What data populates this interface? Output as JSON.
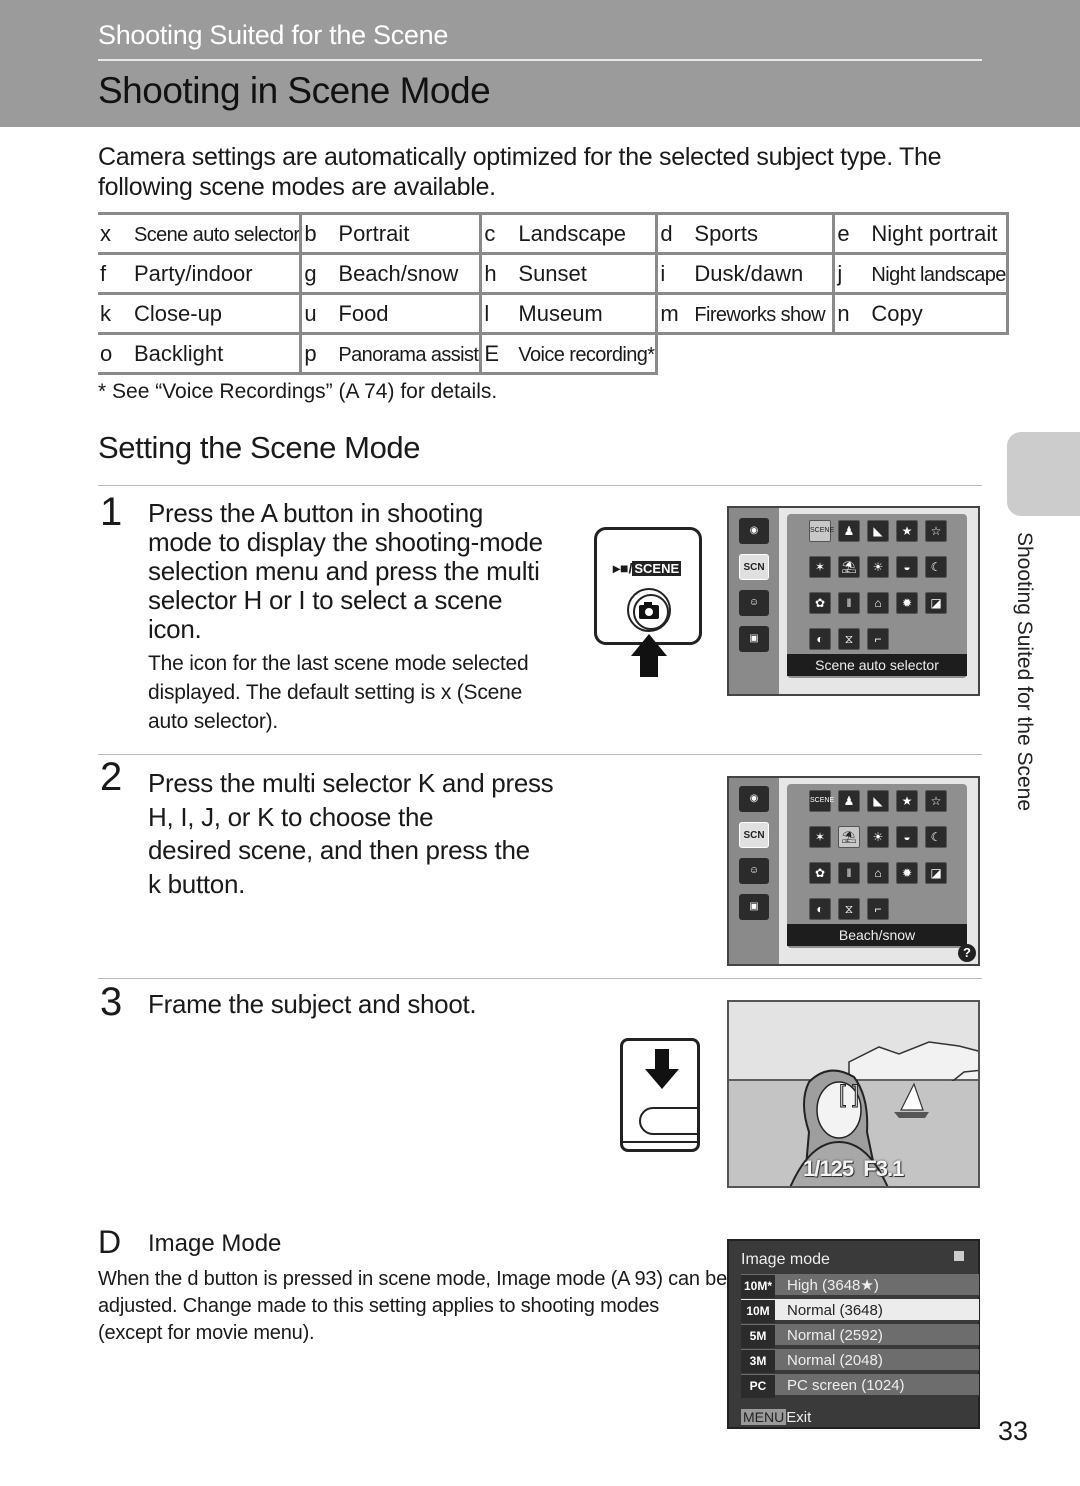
{
  "header": {
    "section": "Shooting Suited for the Scene",
    "title": "Shooting in Scene Mode"
  },
  "intro": "Camera settings are automatically optimized for the selected subject type. The following scene modes are available.",
  "scene_table": {
    "rows": [
      [
        {
          "key": "x",
          "label": "Scene auto selector"
        },
        {
          "key": "b",
          "label": "Portrait"
        },
        {
          "key": "c",
          "label": "Landscape"
        },
        {
          "key": "d",
          "label": "Sports"
        },
        {
          "key": "e",
          "label": "Night portrait"
        }
      ],
      [
        {
          "key": "f",
          "label": "Party/indoor"
        },
        {
          "key": "g",
          "label": "Beach/snow"
        },
        {
          "key": "h",
          "label": "Sunset"
        },
        {
          "key": "i",
          "label": "Dusk/dawn"
        },
        {
          "key": "j",
          "label": "Night landscape"
        }
      ],
      [
        {
          "key": "k",
          "label": "Close-up"
        },
        {
          "key": "u",
          "label": "Food"
        },
        {
          "key": "l",
          "label": "Museum"
        },
        {
          "key": "m",
          "label": "Fireworks show"
        },
        {
          "key": "n",
          "label": "Copy"
        }
      ],
      [
        {
          "key": "o",
          "label": "Backlight"
        },
        {
          "key": "p",
          "label": "Panorama assist"
        },
        {
          "key": "E",
          "label": "Voice recording*"
        }
      ]
    ],
    "footnote": "*  See “Voice Recordings” (A 74) for details."
  },
  "setting_section": {
    "title": "Setting the Scene Mode"
  },
  "steps": [
    {
      "number": "1",
      "text": [
        "Press the A button in shooting",
        "mode to display the shooting-mode",
        "selection menu and press the multi",
        "selector H or I to select a scene",
        "icon."
      ],
      "sub": [
        "The icon for the last scene mode selected",
        "displayed. The default setting is x (Scene",
        "auto selector)."
      ]
    },
    {
      "number": "2",
      "text": [
        "Press the multi selector K and press",
        "H, I, J, or K to choose the",
        "desired scene, and then press the",
        "k button."
      ]
    },
    {
      "number": "3",
      "text": [
        "Frame the subject and shoot."
      ]
    }
  ],
  "button_illustration": {
    "label_movie": "▸■/",
    "label_scene": "SCENE"
  },
  "screen1": {
    "side_icons": [
      "camera",
      "scene",
      "smile",
      "movie"
    ],
    "grid": [
      "SCENE",
      "♟",
      "◣",
      "★",
      "☆",
      "✶",
      "⛱",
      "☀",
      "◒",
      "☾",
      "✿",
      "‖",
      "⌂",
      "✹",
      "◪",
      "◐",
      "⧖",
      "⌐"
    ],
    "caption": "Scene auto selector",
    "selected_index": 0
  },
  "screen2": {
    "caption": "Beach/snow",
    "selected_index": 6,
    "help_icon": "?"
  },
  "photo": {
    "shutter": "1/125",
    "aperture": "F3.1"
  },
  "note": {
    "letter": "D",
    "title": "Image Mode",
    "body": "When the d button is pressed in scene mode, Image mode (A 93) can be adjusted. Change made to this setting applies to shooting modes (except for movie menu)."
  },
  "image_mode_menu": {
    "title": "Image mode",
    "items": [
      {
        "icon": "10M*",
        "label": "High (3648★)",
        "selected": false
      },
      {
        "icon": "10M",
        "label": "Normal (3648)",
        "selected": true
      },
      {
        "icon": "5M",
        "label": "Normal (2592)",
        "selected": false
      },
      {
        "icon": "3M",
        "label": "Normal (2048)",
        "selected": false
      },
      {
        "icon": "PC",
        "label": "PC screen (1024)",
        "selected": false
      }
    ],
    "footer_badge": "MENU",
    "footer_label": "Exit"
  },
  "side_tab_label": "Shooting Suited for the Scene",
  "page_number": "33"
}
